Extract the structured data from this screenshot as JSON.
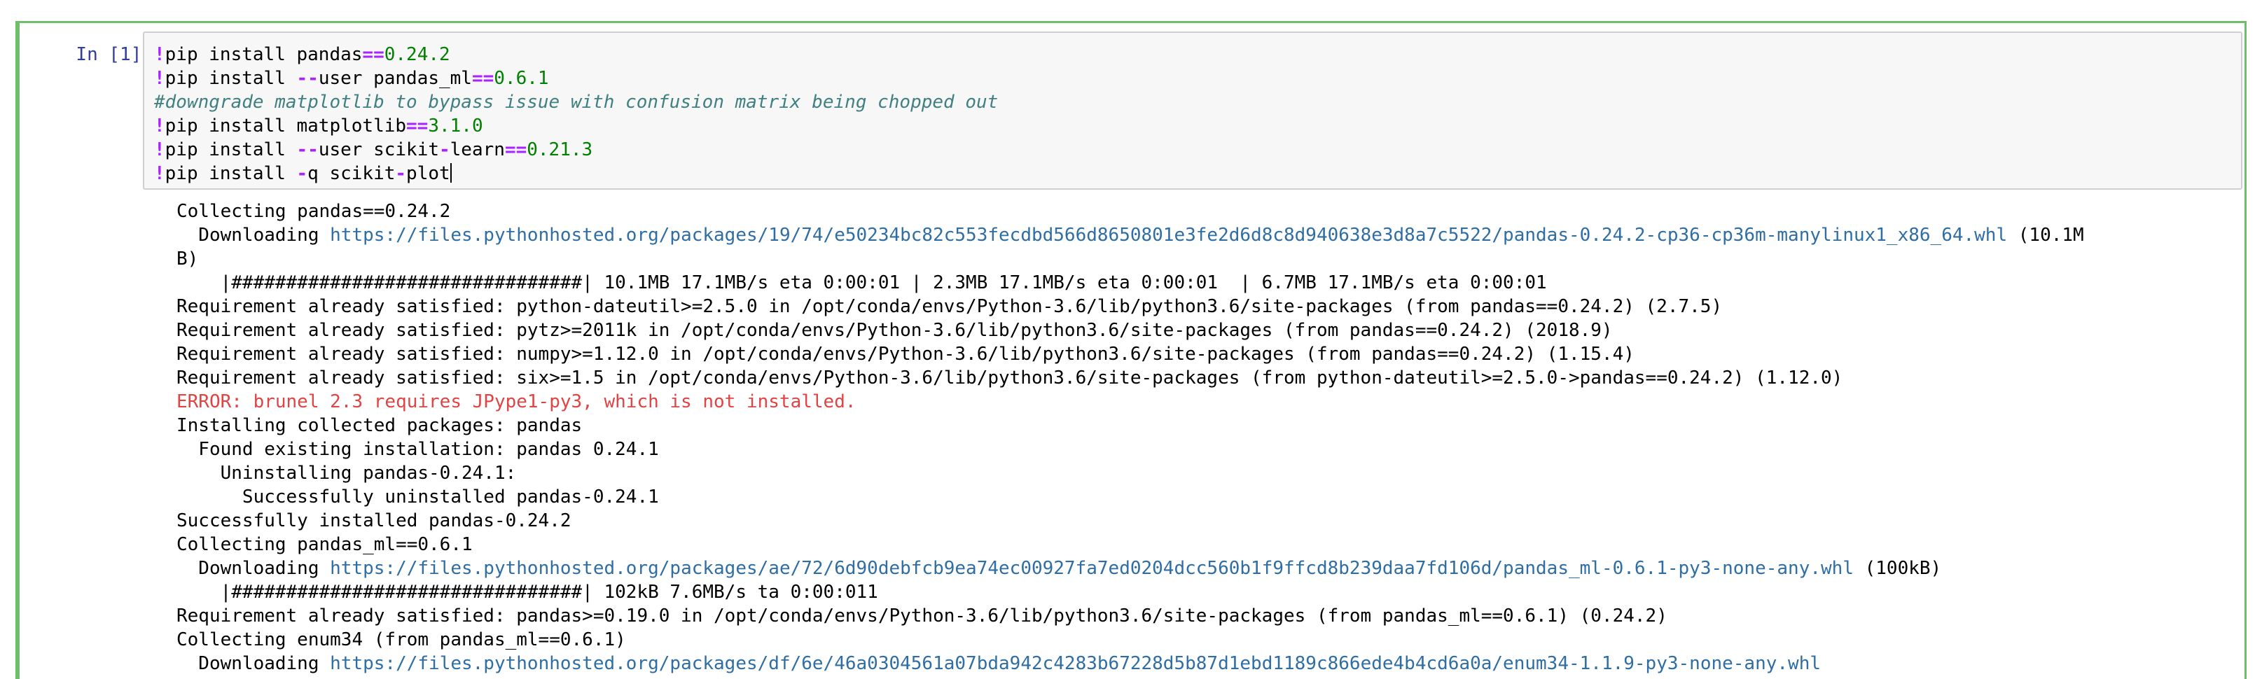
{
  "cell": {
    "prompt": "In [1]:",
    "code_lines": [
      [
        {
          "t": "",
          "c": ""
        },
        {
          "t": "!",
          "c": "op"
        },
        {
          "t": "pip install pandas",
          "c": ""
        },
        {
          "t": "==",
          "c": "op"
        },
        {
          "t": "0.24.2",
          "c": "num"
        }
      ],
      [
        {
          "t": "!",
          "c": "op"
        },
        {
          "t": "pip install ",
          "c": ""
        },
        {
          "t": "--",
          "c": "op"
        },
        {
          "t": "user pandas_ml",
          "c": ""
        },
        {
          "t": "==",
          "c": "op"
        },
        {
          "t": "0.6.1",
          "c": "num"
        }
      ],
      [
        {
          "t": "#downgrade matplotlib to bypass issue with confusion matrix being chopped out",
          "c": "comment"
        }
      ],
      [
        {
          "t": "!",
          "c": "op"
        },
        {
          "t": "pip install matplotlib",
          "c": ""
        },
        {
          "t": "==",
          "c": "op"
        },
        {
          "t": "3.1.0",
          "c": "num"
        }
      ],
      [
        {
          "t": "!",
          "c": "op"
        },
        {
          "t": "pip install ",
          "c": ""
        },
        {
          "t": "--",
          "c": "op"
        },
        {
          "t": "user scikit",
          "c": ""
        },
        {
          "t": "-",
          "c": "op"
        },
        {
          "t": "learn",
          "c": ""
        },
        {
          "t": "==",
          "c": "op"
        },
        {
          "t": "0.21.3",
          "c": "num"
        }
      ],
      [
        {
          "t": "!",
          "c": "op"
        },
        {
          "t": "pip install ",
          "c": ""
        },
        {
          "t": "-",
          "c": "op"
        },
        {
          "t": "q scikit",
          "c": ""
        },
        {
          "t": "-",
          "c": "op"
        },
        {
          "t": "plot",
          "c": ""
        }
      ]
    ],
    "output_lines": [
      {
        "text": "Collecting pandas==0.24.2"
      },
      {
        "text": "  Downloading ",
        "link": "https://files.pythonhosted.org/packages/19/74/e50234bc82c553fecdbd566d8650801e3fe2d6d8c8d940638e3d8a7c5522/pandas-0.24.2-cp36-cp36m-manylinux1_x86_64.whl",
        "after": " (10.1M"
      },
      {
        "text": "B)"
      },
      {
        "text": "    |################################| 10.1MB 17.1MB/s eta 0:00:01 | 2.3MB 17.1MB/s eta 0:00:01  | 6.7MB 17.1MB/s eta 0:00:01"
      },
      {
        "text": "Requirement already satisfied: python-dateutil>=2.5.0 in /opt/conda/envs/Python-3.6/lib/python3.6/site-packages (from pandas==0.24.2) (2.7.5)"
      },
      {
        "text": "Requirement already satisfied: pytz>=2011k in /opt/conda/envs/Python-3.6/lib/python3.6/site-packages (from pandas==0.24.2) (2018.9)"
      },
      {
        "text": "Requirement already satisfied: numpy>=1.12.0 in /opt/conda/envs/Python-3.6/lib/python3.6/site-packages (from pandas==0.24.2) (1.15.4)"
      },
      {
        "text": "Requirement already satisfied: six>=1.5 in /opt/conda/envs/Python-3.6/lib/python3.6/site-packages (from python-dateutil>=2.5.0->pandas==0.24.2) (1.12.0)"
      },
      {
        "text": "ERROR: brunel 2.3 requires JPype1-py3, which is not installed.",
        "error": true
      },
      {
        "text": "Installing collected packages: pandas"
      },
      {
        "text": "  Found existing installation: pandas 0.24.1"
      },
      {
        "text": "    Uninstalling pandas-0.24.1:"
      },
      {
        "text": "      Successfully uninstalled pandas-0.24.1"
      },
      {
        "text": "Successfully installed pandas-0.24.2"
      },
      {
        "text": "Collecting pandas_ml==0.6.1"
      },
      {
        "text": "  Downloading ",
        "link": "https://files.pythonhosted.org/packages/ae/72/6d90debfcb9ea74ec00927fa7ed0204dcc560b1f9ffcd8b239daa7fd106d/pandas_ml-0.6.1-py3-none-any.whl",
        "after": " (100kB)"
      },
      {
        "text": "    |################################| 102kB 7.6MB/s ta 0:00:011"
      },
      {
        "text": "Requirement already satisfied: pandas>=0.19.0 in /opt/conda/envs/Python-3.6/lib/python3.6/site-packages (from pandas_ml==0.6.1) (0.24.2)"
      },
      {
        "text": "Collecting enum34 (from pandas_ml==0.6.1)"
      },
      {
        "text": "  Downloading ",
        "link": "https://files.pythonhosted.org/packages/df/6e/46a0304561a07bda942c4283b67228d5b87d1ebd1189c866ede4b4cd6a0a/enum34-1.1.9-py3-none-any.whl",
        "after": ""
      }
    ]
  },
  "colors": {
    "cell_border": "#6fbe6a",
    "prompt": "#303f9f",
    "link": "#2f6ea5",
    "error": "#e04444"
  }
}
